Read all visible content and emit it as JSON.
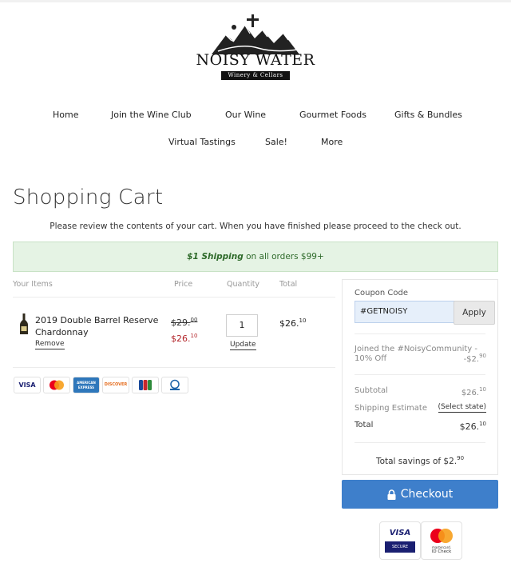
{
  "brand": {
    "name": "NOISY WATER",
    "tagline": "Winery & Cellars"
  },
  "nav": {
    "items": [
      "Home",
      "Join the Wine Club",
      "Our Wine",
      "Gourmet Foods",
      "Gifts & Bundles",
      "Virtual Tastings",
      "Sale!",
      "More"
    ]
  },
  "page": {
    "title": "Shopping Cart",
    "intro": "Please review the contents of your cart. When you have finished please proceed to the check out."
  },
  "promo": {
    "highlight": "$1 Shipping",
    "rest": " on all orders $99+"
  },
  "cart": {
    "headers": {
      "items": "Your Items",
      "price": "Price",
      "quantity": "Quantity",
      "total": "Total"
    },
    "item": {
      "name": "2019 Double Barrel Reserve Chardonnay",
      "remove_label": "Remove",
      "old_price_main": "$29.",
      "old_price_cents": "00",
      "new_price_main": "$26.",
      "new_price_cents": "10",
      "quantity": "1",
      "update_label": "Update",
      "total_main": "$26.",
      "total_cents": "10"
    },
    "payment_cards": [
      "VISA",
      "MasterCard",
      "AMERICAN EXPRESS",
      "DISCOVER",
      "JCB",
      "Diners Club"
    ]
  },
  "summary": {
    "coupon_label": "Coupon Code",
    "coupon_value": "#GETNOISY",
    "apply_label": "Apply",
    "discount_label": "Joined the #NoisyCommunity - 10% Off",
    "discount_main": "-$2.",
    "discount_cents": "90",
    "subtotal_label": "Subtotal",
    "subtotal_main": "$26.",
    "subtotal_cents": "10",
    "shipping_label": "Shipping Estimate",
    "shipping_value": "(Select state)",
    "total_label": "Total",
    "total_main": "$26.",
    "total_cents": "10",
    "savings_label": "Total savings of $2.",
    "savings_cents": "90"
  },
  "checkout": {
    "label": "Checkout",
    "icon": "lock-icon"
  },
  "badges": {
    "visa_line1": "VISA",
    "visa_line2": "SECURE",
    "mc_line1": "mastercard.",
    "mc_line2": "ID Check"
  },
  "colors": {
    "accent": "#3e7fcb",
    "sale_price": "#b3262b",
    "promo_bg": "#e5f3e4",
    "coupon_bg": "#e6effa"
  }
}
